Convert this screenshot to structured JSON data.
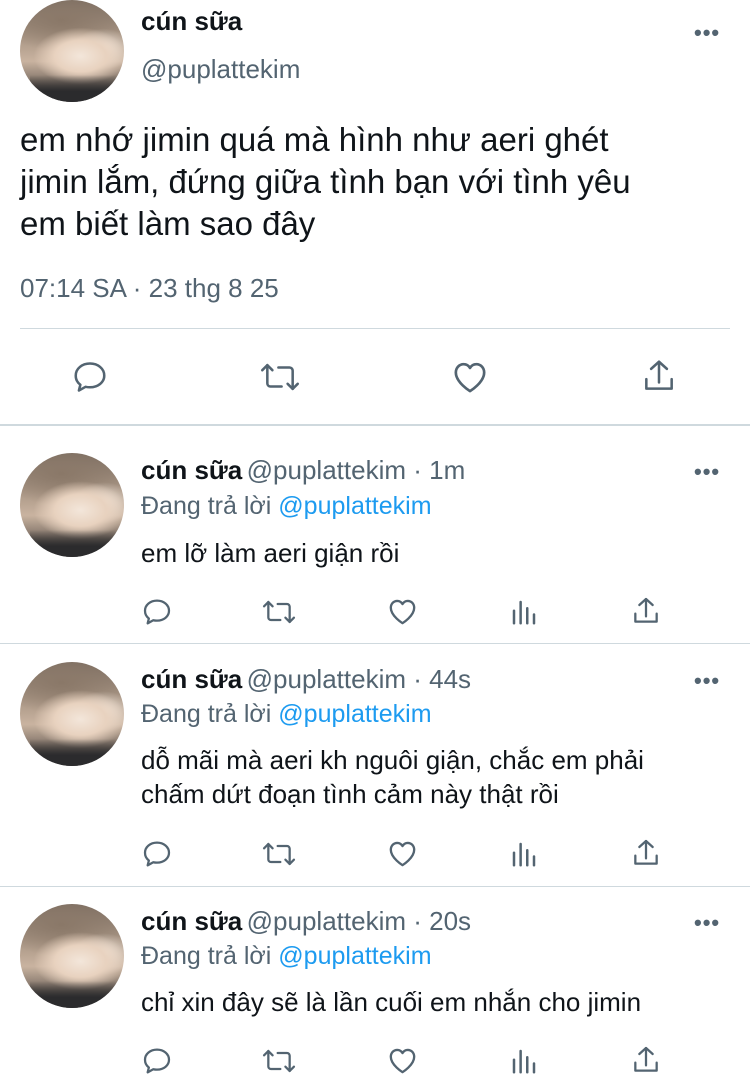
{
  "main_tweet": {
    "author_name": "cún sữa",
    "author_handle": "@puplattekim",
    "more_icon": "more-horizontal-icon",
    "text_lines": [
      "em nhớ jimin quá mà hình như aeri ghét",
      "jimin lắm, đứng giữa tình bạn với tình yêu",
      "em biết làm sao đây"
    ],
    "timestamp": "07:14 SA · 23 thg 8 25",
    "actions": [
      "reply-icon",
      "retweet-icon",
      "like-icon",
      "share-icon"
    ]
  },
  "replies": [
    {
      "author_name": "cún sữa",
      "author_meta": "@puplattekim · 1m",
      "replying_prefix": "Đang trả lời",
      "replying_handle": "@puplattekim",
      "text_lines": [
        "em lỡ làm aeri giận rồi"
      ]
    },
    {
      "author_name": "cún sữa",
      "author_meta": "@puplattekim · 44s",
      "replying_prefix": "Đang trả lời",
      "replying_handle": "@puplattekim",
      "text_lines": [
        "dỗ mãi mà aeri kh nguôi giận, chắc em phải",
        "chấm dứt đoạn tình cảm này thật rồi"
      ]
    },
    {
      "author_name": "cún sữa",
      "author_meta": "@puplattekim · 20s",
      "replying_prefix": "Đang trả lời",
      "replying_handle": "@puplattekim",
      "text_lines": [
        "chỉ xin đây sẽ là lần cuối em nhắn cho jimin"
      ]
    }
  ],
  "reply_actions": [
    "reply-icon",
    "retweet-icon",
    "like-icon",
    "views-icon",
    "share-icon"
  ],
  "more_glyph": "•••",
  "colors": {
    "text": "#0f1419",
    "secondary": "#536471",
    "link": "#1d9bf0",
    "divider": "#cfd9de"
  }
}
